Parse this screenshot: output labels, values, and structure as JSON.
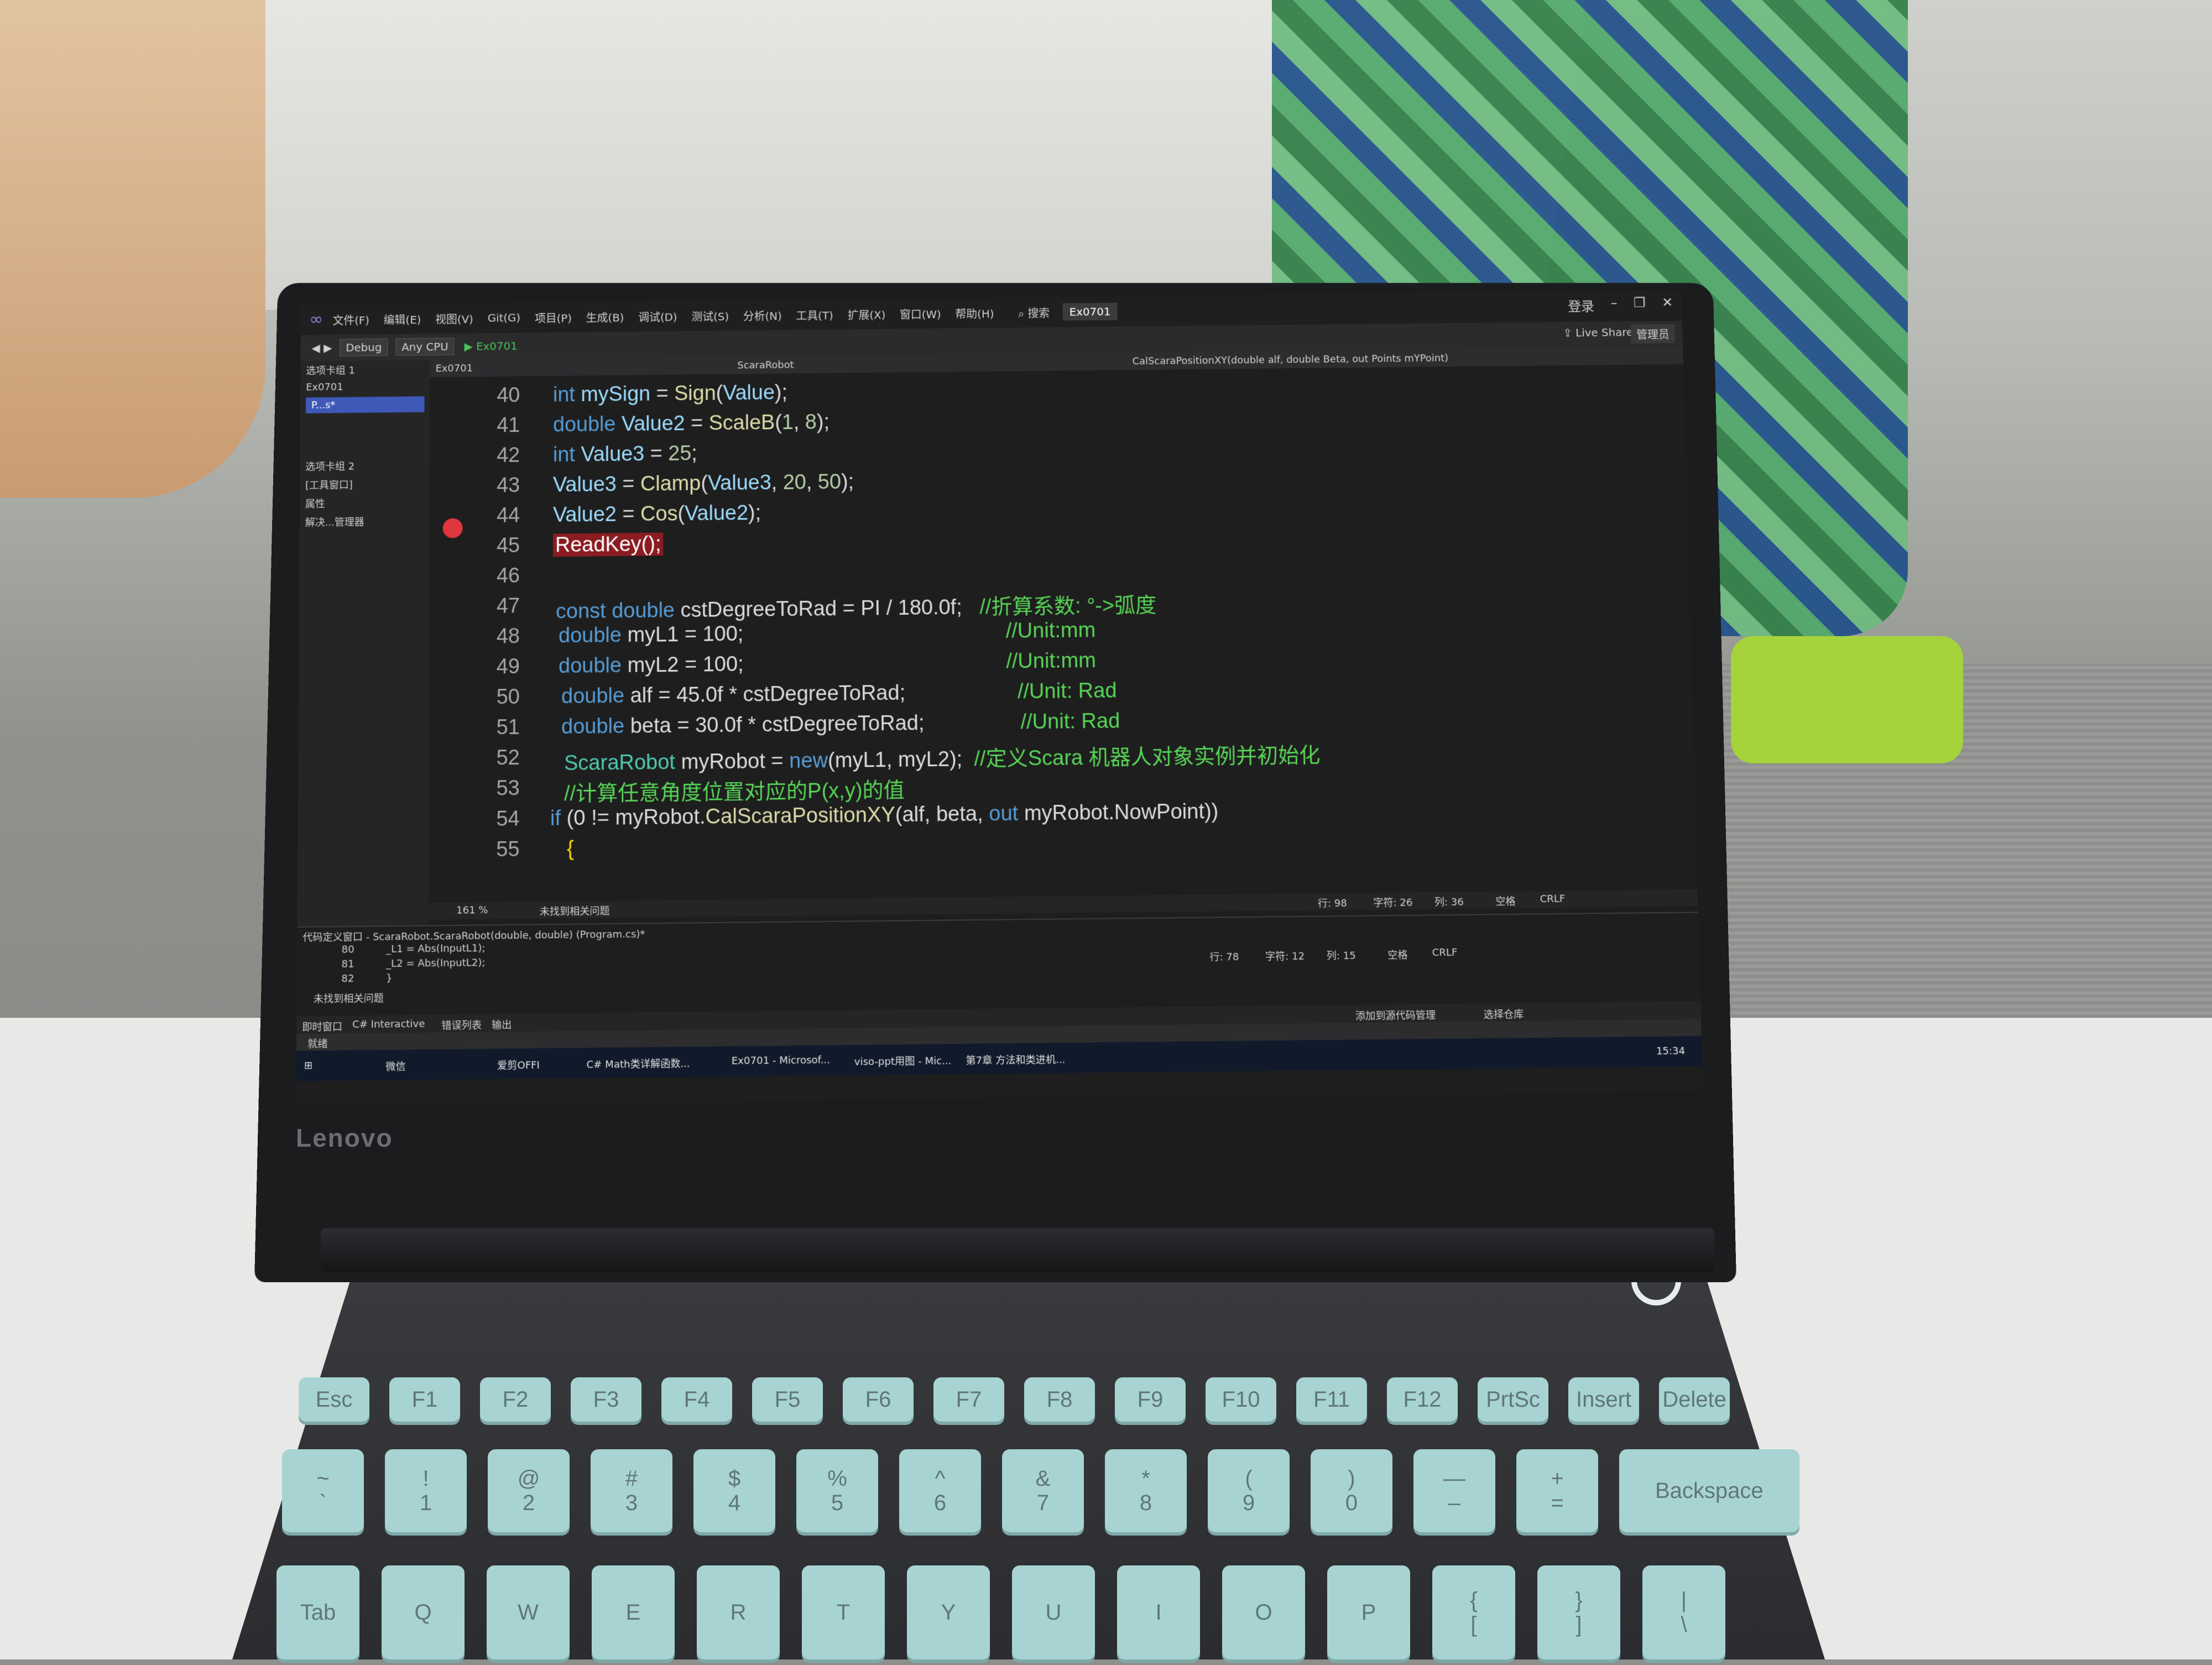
{
  "ide": {
    "menu": [
      "文件(F)",
      "编辑(E)",
      "视图(V)",
      "Git(G)",
      "项目(P)",
      "生成(B)",
      "调试(D)",
      "测试(S)",
      "分析(N)",
      "工具(T)",
      "扩展(X)",
      "窗口(W)",
      "帮助(H)"
    ],
    "search_label": "搜索",
    "solution_badge": "Ex0701",
    "login": "登录",
    "live_share": "Live Share",
    "admin_badge": "管理员",
    "toolbar": {
      "config": "Debug",
      "platform": "Any CPU",
      "run_target": "Ex0701"
    },
    "left_pane": [
      "选项卡组 1",
      "Ex0701",
      "P...s*",
      "选项卡组 2",
      "[工具窗口]",
      "属性",
      "解决...管理器"
    ],
    "editor_tabs": {
      "project": "Ex0701",
      "class": "ScaraRobot",
      "member": "CalScaraPositionXY(double alf, double Beta, out Points mYPoint)"
    },
    "code_lines": [
      {
        "num": "40",
        "text": "int mySign = Sign(Value);"
      },
      {
        "num": "41",
        "text": "double Value2 = ScaleB(1, 8);"
      },
      {
        "num": "42",
        "text": "int Value3 = 25;"
      },
      {
        "num": "43",
        "text": "Value3 = Clamp(Value3, 20, 50);"
      },
      {
        "num": "44",
        "text": "Value2 = Cos(Value2);"
      },
      {
        "num": "45",
        "text": "ReadKey();"
      },
      {
        "num": "46",
        "text": ""
      },
      {
        "num": "47",
        "text": "const double cstDegreeToRad = PI / 180.0f;",
        "comment": "//折算系数: °->弧度"
      },
      {
        "num": "48",
        "text": "double myL1 = 100;",
        "comment": "//Unit:mm"
      },
      {
        "num": "49",
        "text": "double myL2 = 100;",
        "comment": "//Unit:mm"
      },
      {
        "num": "50",
        "text": "double alf = 45.0f * cstDegreeToRad;",
        "comment": "//Unit: Rad"
      },
      {
        "num": "51",
        "text": "double beta = 30.0f * cstDegreeToRad;",
        "comment": "//Unit: Rad"
      },
      {
        "num": "52",
        "text": "ScaraRobot myRobot = new(myL1, myL2);",
        "comment": "//定义Scara 机器人对象实例并初始化"
      },
      {
        "num": "53",
        "text": "",
        "comment": "//计算任意角度位置对应的P(x,y)的值"
      },
      {
        "num": "54",
        "text": "if (0 != myRobot.CalScaraPositionXY(alf, beta, out myRobot.NowPoint))"
      },
      {
        "num": "55",
        "text": "{"
      }
    ],
    "editor_status": {
      "zoom": "161 %",
      "issues": "未找到相关问题",
      "line": "行: 98",
      "char": "字符: 26",
      "col": "列: 36",
      "ws": "空格",
      "eol": "CRLF"
    },
    "peek": {
      "title": "代码定义窗口 - ScaraRobot.ScaraRobot(double, double) (Program.cs)*",
      "lines": [
        {
          "num": "80",
          "text": "_L1 = Abs(InputL1);"
        },
        {
          "num": "81",
          "text": "_L2 = Abs(InputL2);"
        },
        {
          "num": "82",
          "text": "}"
        }
      ],
      "status": {
        "issues": "未找到相关问题",
        "line": "行: 78",
        "char": "字符: 12",
        "col": "列: 15",
        "ws": "空格",
        "eol": "CRLF"
      }
    },
    "bottom_tabs": [
      "即时窗口",
      "C# Interactive",
      "错误列表",
      "输出"
    ],
    "bottom_right": [
      "添加到源代码管理",
      "选择仓库"
    ],
    "status": "就绪"
  },
  "taskbar": {
    "items": [
      "微信",
      "爱剪OFFI",
      "C# Math类详解函数...",
      "Ex0701 - Microsof...",
      "viso-ppt用图 - Mic...",
      "第7章 方法和类进机..."
    ],
    "time": "15:34"
  },
  "laptop": {
    "brand": "Lenovo"
  },
  "keyboard": {
    "row1": [
      "Esc",
      "F1",
      "F2",
      "F3",
      "F4",
      "F5",
      "F6",
      "F7",
      "F8",
      "F9",
      "F10",
      "F11",
      "F12",
      "PrtSc",
      "Insert",
      "Delete"
    ],
    "row2": [
      "~\n`",
      "!\n1",
      "@\n2",
      "#\n3",
      "$\n4",
      "%\n5",
      "^\n6",
      "&\n7",
      "*\n8",
      "(\n9",
      ")\n0",
      "—\n–",
      "+\n=",
      "Backspace"
    ],
    "row3": [
      "Tab",
      "Q",
      "W",
      "E",
      "R",
      "T",
      "Y",
      "U",
      "I",
      "O",
      "P",
      "{\n[",
      "}\n]",
      "|\n\\"
    ]
  }
}
